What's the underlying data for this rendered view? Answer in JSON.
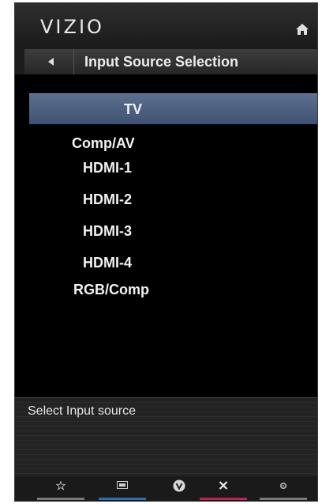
{
  "header": {
    "logo": "VIZIO",
    "home_icon": "home-icon"
  },
  "title_bar": {
    "back_icon": "back-arrow-icon",
    "title": "Input Source Selection"
  },
  "menu": {
    "selected_index": 0,
    "items": [
      {
        "label": "TV"
      },
      {
        "label": "Comp/AV"
      },
      {
        "label": "HDMI-1"
      },
      {
        "label": "HDMI-2"
      },
      {
        "label": "HDMI-3"
      },
      {
        "label": "HDMI-4"
      },
      {
        "label": "RGB/Comp"
      }
    ]
  },
  "help": {
    "text": "Select Input source"
  },
  "bottom_bar": {
    "buttons": [
      {
        "icon": "star-icon",
        "color": "#9a9a9a"
      },
      {
        "icon": "input-icon",
        "color": "#2a6fb8"
      },
      {
        "icon": "vizio-v-icon",
        "color": "#9a9a9a"
      },
      {
        "icon": "close-icon",
        "color": "#c0244a"
      },
      {
        "icon": "gear-icon",
        "color": "#9a9a9a"
      }
    ]
  },
  "colors": {
    "selected_row": "#4a5e80",
    "background": "#000000",
    "text": "#f2f2f2"
  }
}
